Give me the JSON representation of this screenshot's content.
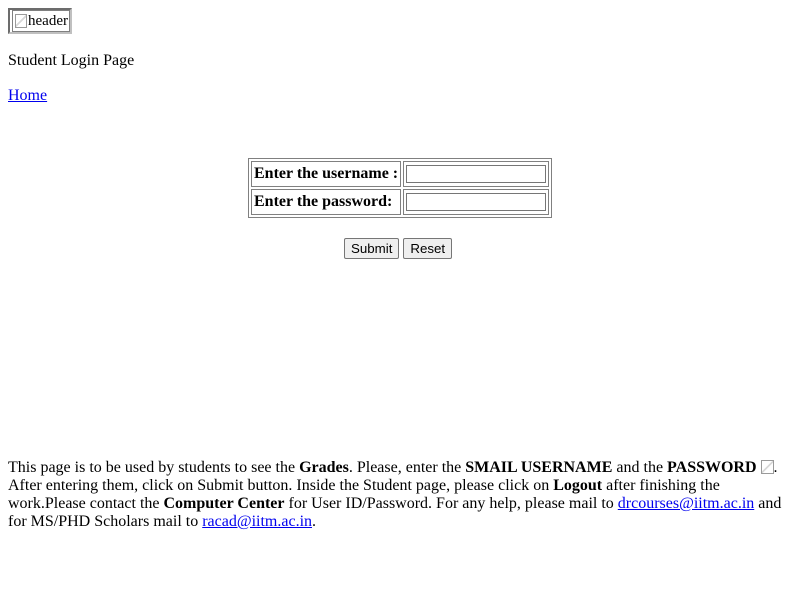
{
  "header": {
    "image_alt": "header",
    "title": "Student Login Page",
    "home_link": "Home"
  },
  "login_form": {
    "username_label": "Enter the username :",
    "password_label": "Enter the password:",
    "username_value": "",
    "password_value": "",
    "submit_label": "Submit",
    "reset_label": "Reset"
  },
  "info": {
    "t1": "This page is to be used by students to see the ",
    "b1": "Grades",
    "t2": ". Please, enter the ",
    "b2": "SMAIL USERNAME",
    "t3": " and the ",
    "b3": "PASSWORD",
    "t4": ". After entering them, click on Submit button. Inside the Student page, please click on ",
    "b4": "Logout",
    "t5": " after finishing the work.Please contact the ",
    "b5": "Computer Center",
    "t6": " for User ID/Password. For any help, please mail to ",
    "link1": "drcourses@iitm.ac.in",
    "t7": " and for MS/PHD Scholars mail to ",
    "link2": "racad@iitm.ac.in",
    "t8": "."
  }
}
